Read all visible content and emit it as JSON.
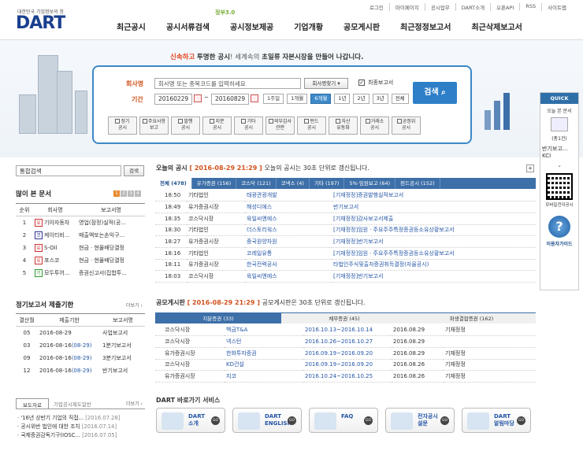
{
  "header": {
    "tagline": "대한민국 기업정보의 창",
    "logo": "DART",
    "gov_badge": "정부3.0",
    "util": [
      "로그인",
      "마이페이지",
      "공시업무",
      "DART소개",
      "오픈API",
      "RSS",
      "사이트맵"
    ],
    "gnb": [
      "최근공시",
      "공시서류검색",
      "공시정보제공",
      "기업개황",
      "공모게시판",
      "최근정정보고서",
      "최근삭제보고서"
    ]
  },
  "banner": {
    "slogan_a": "신속하고",
    "slogan_b": "투명한 공시",
    "slogan_c": "! 세계속의",
    "slogan_d": "초일류",
    "slogan_e": "자본시장을 만들어 나갑니다."
  },
  "search": {
    "company_label": "회사명",
    "period_label": "기간",
    "company_placeholder": "회사명 또는 종목코드를 입력하세요",
    "company_search_btn": "회사명찾기",
    "final_report": "최종보고서",
    "date_from": "20160229",
    "date_to": "20160829",
    "periods": [
      "1주일",
      "1개월",
      "6개월",
      "1년",
      "2년",
      "3년",
      "전체"
    ],
    "active_period": "6개월",
    "search_btn": "검색",
    "categories": [
      [
        "정기",
        "공시"
      ],
      [
        "주요사항",
        "보고"
      ],
      [
        "발행",
        "공시"
      ],
      [
        "지분",
        "공시"
      ],
      [
        "기타",
        "공시"
      ],
      [
        "외부감사",
        "관련"
      ],
      [
        "펀드",
        "공시"
      ],
      [
        "자산",
        "유동화"
      ],
      [
        "거래소",
        "공시"
      ],
      [
        "공정위",
        "공시"
      ]
    ]
  },
  "quick": {
    "title": "QUICK",
    "today_docs": "오늘 본 문서",
    "count": "(총1건)",
    "doc_name": "반기보고...",
    "doc_co": "KCI",
    "qr_label": "모바일전자공시",
    "guide_label": "이용자가이드"
  },
  "left": {
    "total_search_placeholder": "통합검색",
    "total_search_btn": "검색",
    "popular_title": "많이 본 문서",
    "popular_pages": [
      "1",
      "2",
      "3",
      "4"
    ],
    "popular_headers": [
      "순위",
      "회사명",
      "보고서명"
    ],
    "popular": [
      {
        "rank": "1",
        "badge": "유",
        "co": "기아자동차",
        "rep": "영업(잠정)실적(공..."
      },
      {
        "rank": "2",
        "badge": "코",
        "co": "케이티비...",
        "rep": "매출액또는손익구..."
      },
      {
        "rank": "3",
        "badge": "유",
        "co": "S-Oil",
        "rep": "현금ㆍ현물배당결정"
      },
      {
        "rank": "4",
        "badge": "유",
        "co": "포스코",
        "rep": "현금ㆍ현물배당결정"
      },
      {
        "rank": "5",
        "badge": "기",
        "co": "모두투어...",
        "rep": "증권신고서(집합투..."
      }
    ],
    "periodic_title": "정기보고서 제출기한",
    "more": "더보기",
    "periodic_headers": [
      "결산월",
      "제출기한",
      "보고서명"
    ],
    "periodic": [
      {
        "m": "05",
        "d": "2016-08-29",
        "e": "",
        "r": "사업보고서"
      },
      {
        "m": "03",
        "d": "2016-08-16",
        "e": "(08-29)",
        "r": "1분기보고서"
      },
      {
        "m": "09",
        "d": "2016-08-16",
        "e": "(08-29)",
        "r": "3분기보고서"
      },
      {
        "m": "12",
        "d": "2016-08-16",
        "e": "(08-29)",
        "r": "반기보고서"
      }
    ],
    "news_tabs": [
      "보도자료",
      "기업공시제도일반"
    ],
    "news": [
      {
        "t": "'16년 상반기 기업의 직접...",
        "d": "[2016.07.28]"
      },
      {
        "t": "공시위반 법인에 대한 조치",
        "d": "[2016.07.14]"
      },
      {
        "t": "국제증권감독기구(IOSC...",
        "d": "[2016.07.05]"
      }
    ]
  },
  "today": {
    "title": "오늘의 공시",
    "time": "[ 2016-08-29 21:29 ]",
    "note": "오늘의 공시는 30초 단위로 갱신됩니다.",
    "tabs": [
      "전체 (478)",
      "유가증권 (156)",
      "코스닥 (121)",
      "코넥스 (4)",
      "기타 (197)",
      "5%·임원보고 (64)",
      "펀드공시 (152)"
    ],
    "rows": [
      [
        "18:50",
        "기타법인",
        "태광관광개발",
        "[기재정정]증권발행실적보고서"
      ],
      [
        "18:49",
        "유가증권시장",
        "해성디에스",
        "반기보고서"
      ],
      [
        "18:35",
        "코스닥시장",
        "육일씨엔에스",
        "[기재정정]감사보고서제출"
      ],
      [
        "18:30",
        "기타법인",
        "더스토리웍스",
        "[기재정정]임원ㆍ주요주주특정증권등소유상황보고서"
      ],
      [
        "18:27",
        "유가증권시장",
        "중국원양자원",
        "[기재정정]반기보고서"
      ],
      [
        "18:16",
        "기타법인",
        "코레일유통",
        "[기재정정]임원ㆍ주요주주특정증권등소유상황보고서"
      ],
      [
        "18:11",
        "유가증권시장",
        "한국전력공사",
        "타법인주식및출자증권취득결정(자율공시)"
      ],
      [
        "18:03",
        "코스닥시장",
        "육일씨엔에스",
        "[기재정정]반기보고서"
      ]
    ]
  },
  "ipo": {
    "title": "공모게시판",
    "time": "[ 2016-08-29 21:29 ]",
    "note": "공모게시판은 30초 단위로 갱신됩니다.",
    "tabs": [
      "지분증권 (33)",
      "채무증권 (45)",
      "파생결합증권 (162)"
    ],
    "rows": [
      [
        "코스닥시장",
        "백금T&A",
        "2016.10.13~2016.10.14",
        "2016.08.29",
        "기재정정"
      ],
      [
        "코스닥시장",
        "넥스턴",
        "2016.10.26~2016.10.27",
        "2016.08.29",
        ""
      ],
      [
        "유가증권시장",
        "한화투자증권",
        "2016.09.19~2016.09.20",
        "2016.08.29",
        "기재정정"
      ],
      [
        "코스닥시장",
        "KD건설",
        "2016.09.19~2016.09.20",
        "2016.08.26",
        "기재정정"
      ],
      [
        "유가증권시장",
        "지코",
        "2016.10.24~2016.10.25",
        "2016.08.26",
        "기재정정"
      ]
    ]
  },
  "shortcuts": {
    "title": "DART 바로가기 서비스",
    "items": [
      [
        "DART",
        "소개"
      ],
      [
        "DART",
        "ENGLISH"
      ],
      [
        "FAQ",
        ""
      ],
      [
        "전자공시",
        "설문"
      ],
      [
        "DART",
        "알림마당"
      ]
    ],
    "go": "GO"
  }
}
